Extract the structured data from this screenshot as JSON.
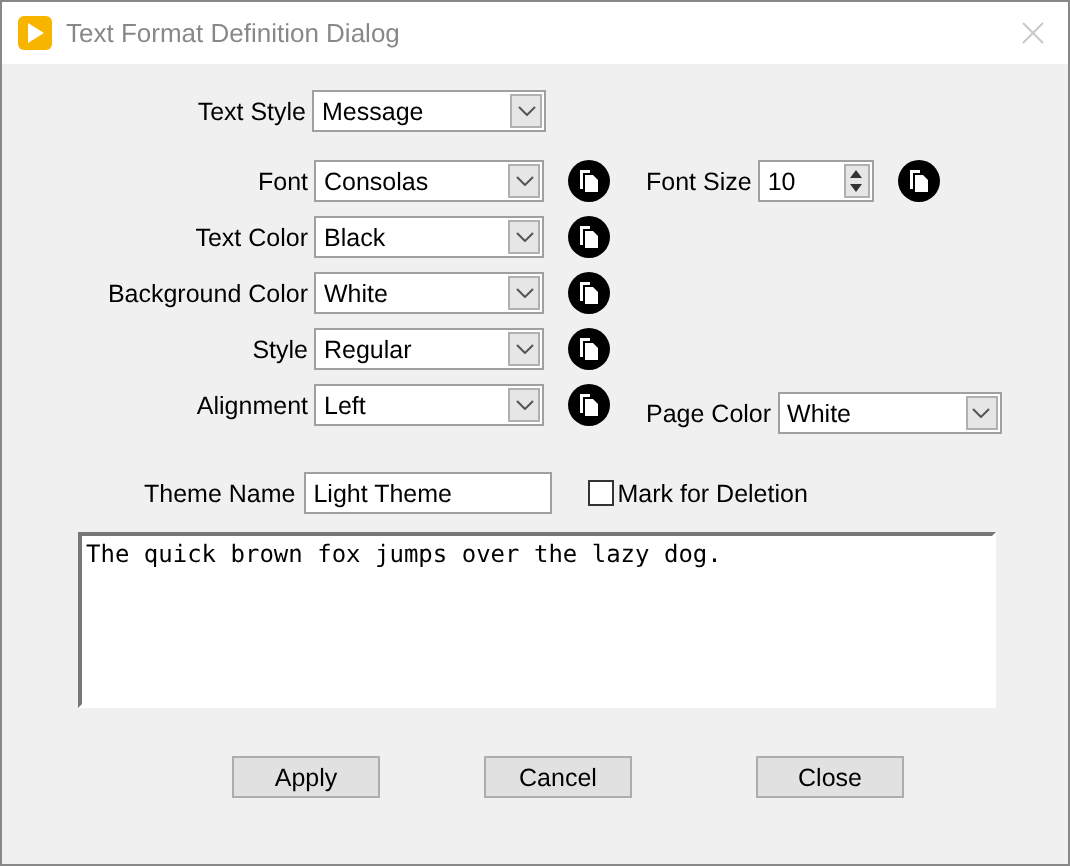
{
  "window": {
    "title": "Text Format Definition Dialog"
  },
  "text_style": {
    "label": "Text Style",
    "value": "Message"
  },
  "properties": [
    {
      "label": "Font",
      "value": "Consolas"
    },
    {
      "label": "Text Color",
      "value": "Black"
    },
    {
      "label": "Background Color",
      "value": "White"
    },
    {
      "label": "Style",
      "value": "Regular"
    },
    {
      "label": "Alignment",
      "value": "Left"
    }
  ],
  "font_size": {
    "label": "Font Size",
    "value": "10"
  },
  "page_color": {
    "label": "Page Color",
    "value": "White"
  },
  "theme_name": {
    "label": "Theme Name",
    "value": "Light Theme"
  },
  "mark_for_deletion": {
    "label": "Mark for Deletion",
    "checked": false
  },
  "preview": {
    "text": "The quick brown fox jumps over the lazy dog."
  },
  "buttons": [
    "Apply",
    "Cancel",
    "Close"
  ]
}
